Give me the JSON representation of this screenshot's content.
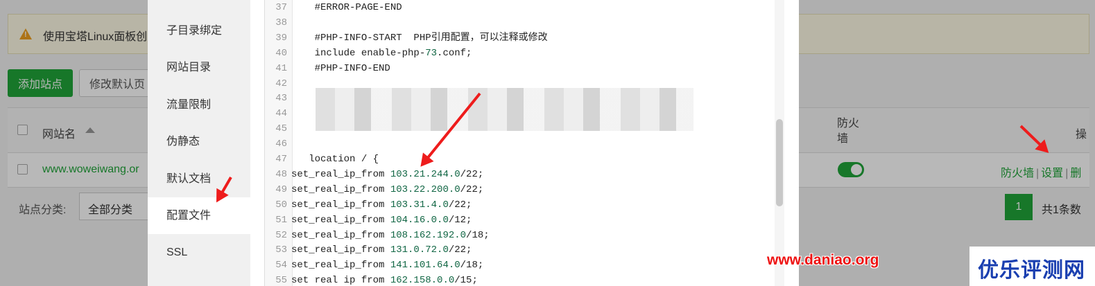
{
  "notice": {
    "text": "使用宝塔Linux面板创"
  },
  "toolbar": {
    "add_site_label": "添加站点",
    "default_page_label": "修改默认页"
  },
  "table": {
    "col_site_name": "网站名",
    "col_firewall": "防火墙",
    "col_operation": "操",
    "row": {
      "site": "www.woweiwang.or",
      "firewall_enabled": true,
      "ops": [
        "防火墙",
        "设置",
        "删"
      ]
    }
  },
  "footer": {
    "category_label": "站点分类:",
    "category_value": "全部分类",
    "page_number": "1",
    "total_text": "共1条数"
  },
  "modal": {
    "nav": [
      "子目录绑定",
      "网站目录",
      "流量限制",
      "伪静态",
      "默认文档",
      "配置文件",
      "SSL"
    ],
    "active_nav": "配置文件",
    "code_lines": [
      {
        "ln": "37",
        "text": "    #ERROR-PAGE-END",
        "num": ""
      },
      {
        "ln": "38",
        "text": "",
        "num": ""
      },
      {
        "ln": "39",
        "text": "    #PHP-INFO-START  PHP引用配置，可以注释或修改",
        "num": ""
      },
      {
        "ln": "40",
        "text": "    include enable-php-",
        "num": "73",
        "after": ".conf;"
      },
      {
        "ln": "41",
        "text": "    #PHP-INFO-END",
        "num": ""
      },
      {
        "ln": "42",
        "text": "",
        "num": ""
      },
      {
        "ln": "43",
        "text": "",
        "num": ""
      },
      {
        "ln": "44",
        "text": "",
        "num": ""
      },
      {
        "ln": "45",
        "text": "    ",
        "num": ""
      },
      {
        "ln": "46",
        "text": "",
        "num": ""
      },
      {
        "ln": "47",
        "text": "   location / {",
        "num": ""
      },
      {
        "ln": "48",
        "text": "set_real_ip_from ",
        "num": "103.21.244.0",
        "after": "/22;"
      },
      {
        "ln": "49",
        "text": "set_real_ip_from ",
        "num": "103.22.200.0",
        "after": "/22;"
      },
      {
        "ln": "50",
        "text": "set_real_ip_from ",
        "num": "103.31.4.0",
        "after": "/22;"
      },
      {
        "ln": "51",
        "text": "set_real_ip_from ",
        "num": "104.16.0.0",
        "after": "/12;"
      },
      {
        "ln": "52",
        "text": "set_real_ip_from ",
        "num": "108.162.192.0",
        "after": "/18;"
      },
      {
        "ln": "53",
        "text": "set_real_ip_from ",
        "num": "131.0.72.0",
        "after": "/22;"
      },
      {
        "ln": "54",
        "text": "set_real_ip_from ",
        "num": "141.101.64.0",
        "after": "/18;"
      },
      {
        "ln": "55",
        "text": "set real ip from ",
        "num": "162.158.0.0",
        "after": "/15;"
      }
    ]
  },
  "watermark": {
    "url": "www.daniao.org",
    "brand": "优乐评测网"
  },
  "colors": {
    "accent": "#20a53a",
    "arrow": "#ee1c1c",
    "brand_blue": "#1a3fb0"
  }
}
